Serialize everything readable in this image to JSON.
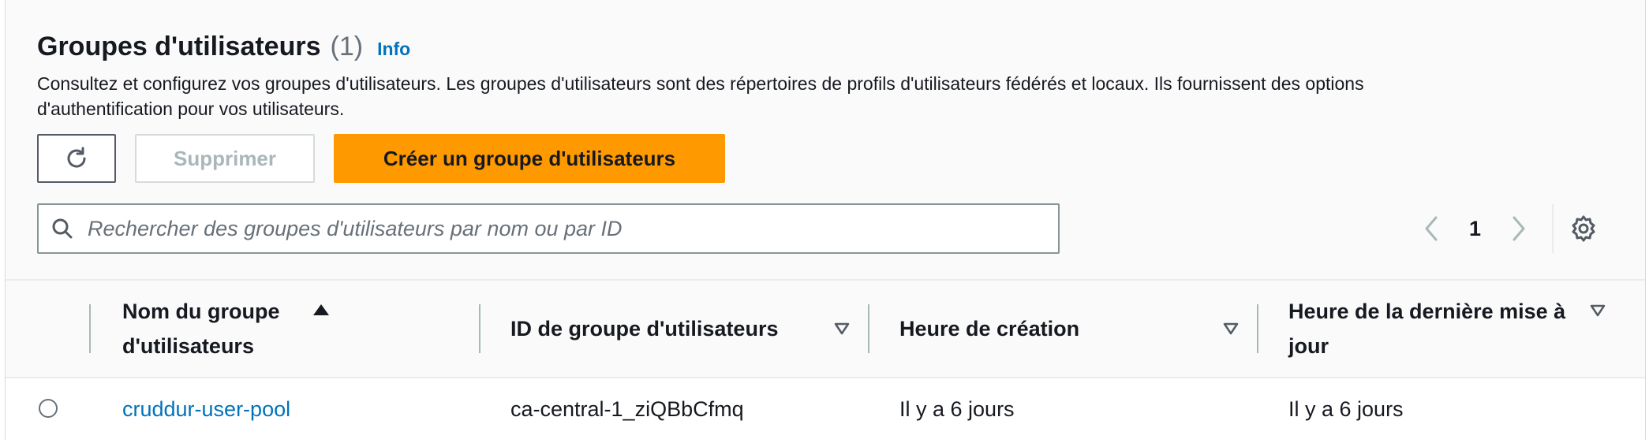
{
  "header": {
    "title": "Groupes d'utilisateurs",
    "count": "(1)",
    "info_link": "Info",
    "description": "Consultez et configurez vos groupes d'utilisateurs. Les groupes d'utilisateurs sont des répertoires de profils d'utilisateurs fédérés et locaux. Ils fournissent des options d'authentification pour vos utilisateurs."
  },
  "toolbar": {
    "refresh_icon": "refresh-icon",
    "delete_label": "Supprimer",
    "create_label": "Créer un groupe d'utilisateurs"
  },
  "search": {
    "placeholder": "Rechercher des groupes d'utilisateurs par nom ou par ID",
    "value": ""
  },
  "pagination": {
    "current_page": "1",
    "prev_icon": "chevron-left-icon",
    "next_icon": "chevron-right-icon",
    "settings_icon": "gear-icon"
  },
  "table": {
    "columns": [
      {
        "label": "Nom du groupe d'utilisateurs",
        "sort": "ascending"
      },
      {
        "label": "ID de groupe d'utilisateurs",
        "sort": "none"
      },
      {
        "label": "Heure de création",
        "sort": "none"
      },
      {
        "label": "Heure de la dernière mise à jour",
        "sort": "none"
      }
    ],
    "rows": [
      {
        "name": "cruddur-user-pool",
        "id": "ca-central-1_ziQBbCfmq",
        "created": "Il y a 6 jours",
        "updated": "Il y a 6 jours"
      }
    ]
  },
  "colors": {
    "accent": "#ff9900",
    "link": "#0073bb",
    "disabled_text": "#aab7b8"
  }
}
